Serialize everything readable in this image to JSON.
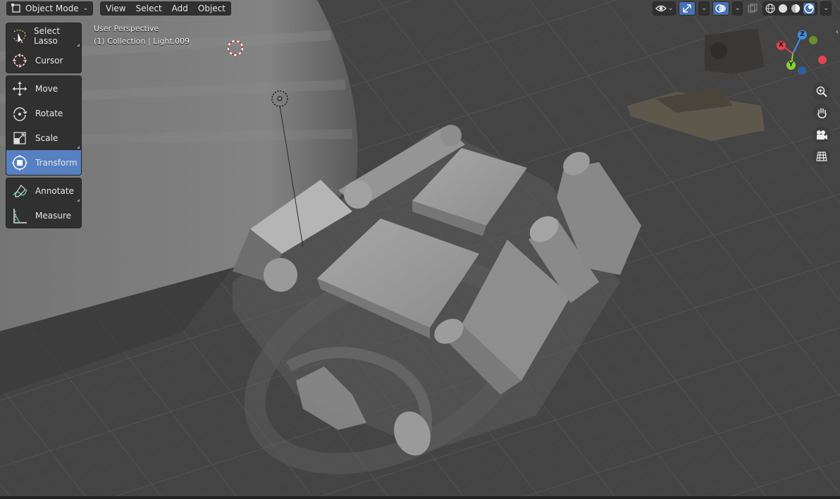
{
  "header": {
    "mode_label": "Object Mode",
    "menus": [
      "View",
      "Select",
      "Add",
      "Object"
    ],
    "right_icons": [
      "visibility-eye-icon",
      "gizmo-icon",
      "overlay-icon",
      "xray-icon",
      "wireframe-shading-icon",
      "solid-shading-icon",
      "material-shading-icon",
      "rendered-shading-icon"
    ]
  },
  "toolbar": {
    "select_lasso": "Select Lasso",
    "cursor": "Cursor",
    "move": "Move",
    "rotate": "Rotate",
    "scale": "Scale",
    "transform": "Transform",
    "annotate": "Annotate",
    "measure": "Measure",
    "active_tool": "Transform",
    "active_color": "#5680c2"
  },
  "viewport_info": {
    "perspective": "User Perspective",
    "collection": "(1) Collection | Light.009"
  },
  "gizmo": {
    "x_label": "X",
    "y_label": "Y",
    "z_label": "Z",
    "x_color": "#e5434f",
    "y_color": "#8bd12d",
    "z_color": "#3f8ee6"
  },
  "nav_icons": [
    "zoom-icon",
    "pan-hand-icon",
    "camera-icon",
    "grid-ortho-icon"
  ]
}
